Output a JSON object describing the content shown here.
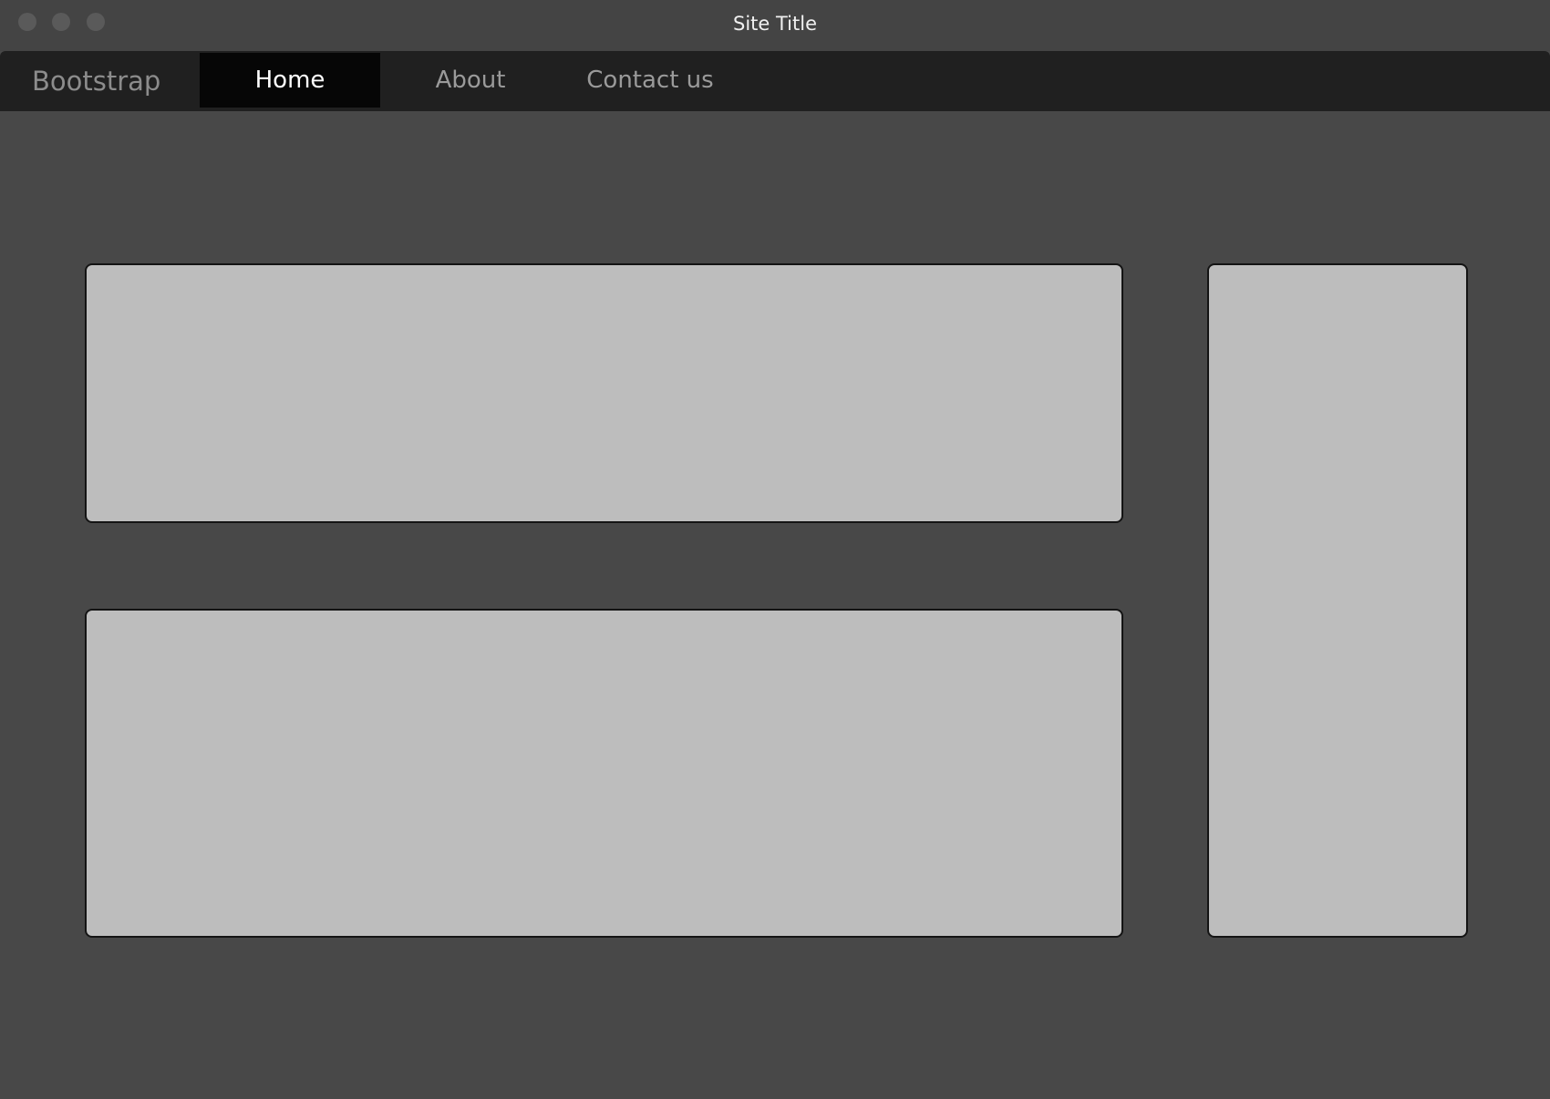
{
  "window": {
    "title": "Site Title"
  },
  "navbar": {
    "brand": "Bootstrap",
    "items": [
      {
        "label": "Home",
        "active": true
      },
      {
        "label": "About",
        "active": false
      },
      {
        "label": "Contact us",
        "active": false
      }
    ]
  },
  "colors": {
    "background": "#484848",
    "navbar": "#202020",
    "active_tab": "#060606",
    "panel_fill": "#bdbdbd",
    "panel_border": "#141414"
  }
}
